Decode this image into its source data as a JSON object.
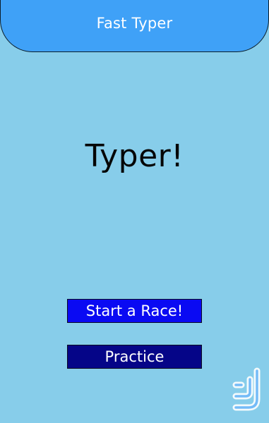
{
  "header": {
    "title": "Fast Typer"
  },
  "main": {
    "hero_text": "Typer!",
    "buttons": {
      "start_race": "Start a Race!",
      "practice": "Practice"
    }
  },
  "colors": {
    "background": "#87cdea",
    "header": "#3fa1f7",
    "start_race_button": "#0a0af3",
    "practice_button": "#050588"
  },
  "icons": {
    "watermark": "store-logo-icon"
  }
}
